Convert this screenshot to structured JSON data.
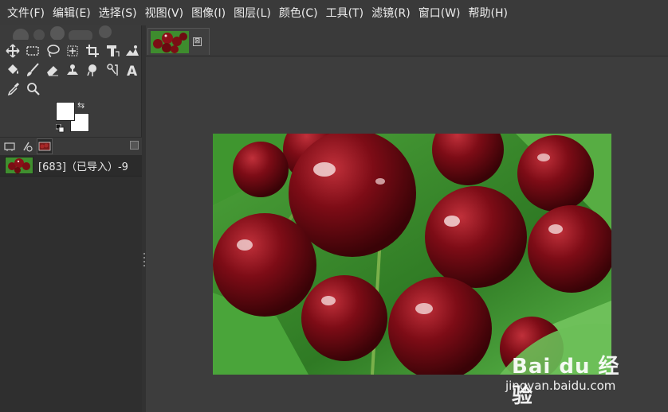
{
  "menubar": {
    "items": [
      "文件(F)",
      "编辑(E)",
      "选择(S)",
      "视图(V)",
      "图像(I)",
      "图层(L)",
      "颜色(C)",
      "工具(T)",
      "滤镜(R)",
      "窗口(W)",
      "帮助(H)"
    ]
  },
  "toolbox": {
    "rows": [
      [
        "move-tool-icon",
        "rect-select-tool-icon",
        "free-select-tool-icon",
        "fuzzy-select-tool-icon",
        "crop-tool-icon",
        "transform-tool-icon",
        "warp-tool-icon"
      ],
      [
        "bucket-fill-tool-icon",
        "paintbrush-tool-icon",
        "eraser-tool-icon",
        "clone-tool-icon",
        "smudge-tool-icon",
        "dodge-burn-tool-icon",
        "text-tool-icon"
      ],
      [
        "color-picker-tool-icon",
        "zoom-tool-icon"
      ]
    ]
  },
  "colors": {
    "foreground": "#ffffff",
    "background": "#ffffff",
    "accent_dark": "#2b2b2b"
  },
  "dock": {
    "tabs": [
      "tool-options-tab",
      "device-status-tab",
      "layers-tab"
    ],
    "active_tab": "layers-tab"
  },
  "layers": [
    {
      "name": "[683]（已导入）-9"
    }
  ],
  "image_window": {
    "tab_close": "⊠"
  },
  "watermark": {
    "logo": "Bai du 经验",
    "url": "jingyan.baidu.com"
  }
}
